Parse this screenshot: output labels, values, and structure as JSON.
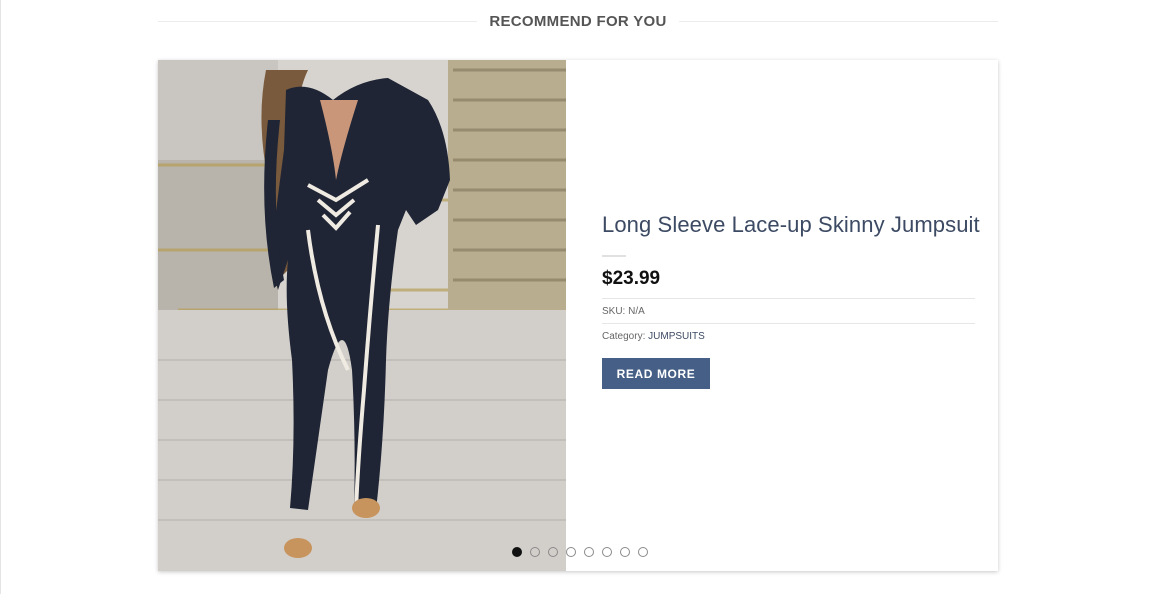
{
  "section": {
    "title": "RECOMMEND FOR YOU"
  },
  "product": {
    "title": "Long Sleeve Lace-up Skinny Jumpsuit",
    "price": "$23.99",
    "sku_label": "SKU:",
    "sku_value": "N/A",
    "category_label": "Category:",
    "category_value": "JUMPSUITS",
    "cta_label": "READ MORE",
    "image_alt": "Long Sleeve Lace-up Skinny Jumpsuit"
  },
  "carousel": {
    "slide_count": 8,
    "active_index": 0
  },
  "colors": {
    "title": "#3c4a63",
    "button": "#455f86",
    "garment": "#1f2535",
    "trim": "#f0ebe2"
  }
}
